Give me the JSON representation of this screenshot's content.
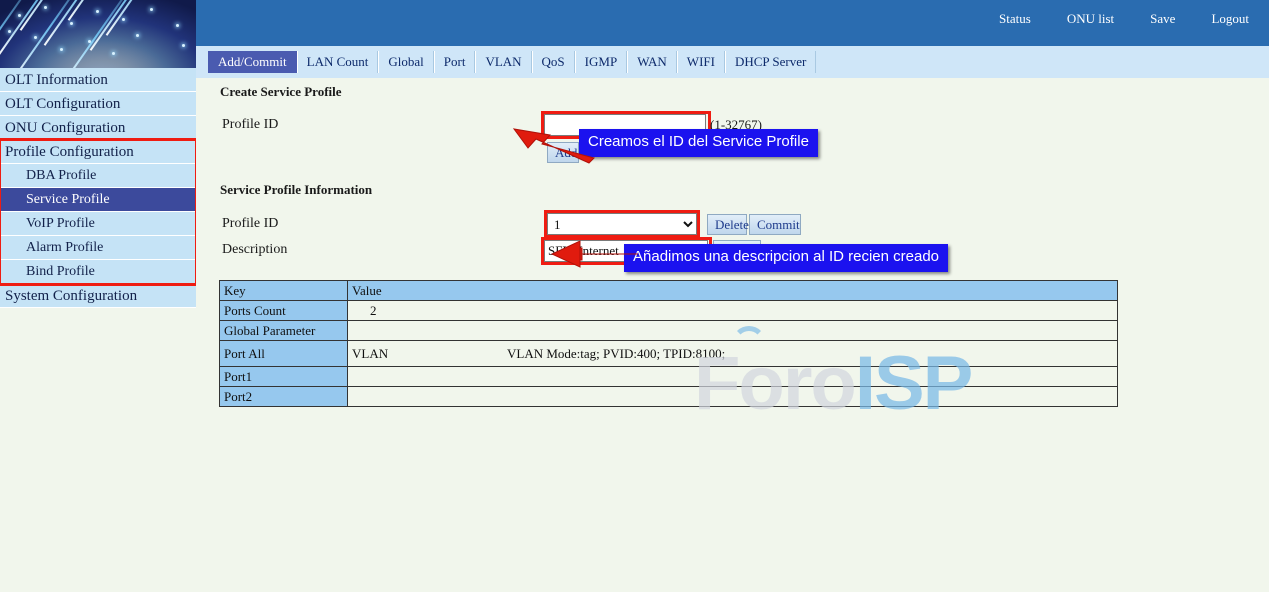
{
  "header": {
    "links": [
      {
        "label": "Status",
        "name": "status"
      },
      {
        "label": "ONU list",
        "name": "onu-list"
      },
      {
        "label": "Save",
        "name": "save"
      },
      {
        "label": "Logout",
        "name": "logout"
      }
    ]
  },
  "sidebar": {
    "items": [
      {
        "label": "OLT Information",
        "level": 0,
        "active": false
      },
      {
        "label": "OLT Configuration",
        "level": 0,
        "active": false
      },
      {
        "label": "ONU Configuration",
        "level": 0,
        "active": false
      },
      {
        "label": "Profile Configuration",
        "level": 0,
        "active": false
      },
      {
        "label": "DBA Profile",
        "level": 1,
        "active": false
      },
      {
        "label": "Service Profile",
        "level": 1,
        "active": true
      },
      {
        "label": "VoIP Profile",
        "level": 1,
        "active": false
      },
      {
        "label": "Alarm Profile",
        "level": 1,
        "active": false
      },
      {
        "label": "Bind Profile",
        "level": 1,
        "active": false
      },
      {
        "label": "System Configuration",
        "level": 0,
        "active": false
      }
    ]
  },
  "tabs": [
    {
      "label": "Add/Commit",
      "active": true
    },
    {
      "label": "LAN Count",
      "active": false
    },
    {
      "label": "Global",
      "active": false
    },
    {
      "label": "Port",
      "active": false
    },
    {
      "label": "VLAN",
      "active": false
    },
    {
      "label": "QoS",
      "active": false
    },
    {
      "label": "IGMP",
      "active": false
    },
    {
      "label": "WAN",
      "active": false
    },
    {
      "label": "WIFI",
      "active": false
    },
    {
      "label": "DHCP Server",
      "active": false
    }
  ],
  "create_section": {
    "title": "Create Service Profile",
    "profile_id_label": "Profile ID",
    "profile_id_value": "",
    "profile_id_placeholder": "",
    "range_hint": "(1-32767)",
    "add_button": "Add"
  },
  "info_section": {
    "title": "Service Profile Information",
    "profile_id_label": "Profile ID",
    "profile_id_selected": "1",
    "profile_id_options": [
      "1"
    ],
    "delete_button": "Delete",
    "commit_button": "Commit",
    "description_label": "Description",
    "description_value": "SFU_Internet",
    "submit_button": "Submit"
  },
  "callouts": [
    {
      "text": "Creamos el ID del Service Profile"
    },
    {
      "text": "Añadimos una descripcion al ID recien creado"
    }
  ],
  "table": {
    "headers": [
      "Key",
      "Value"
    ],
    "rows": [
      {
        "key": "Ports Count",
        "value": "2",
        "sub_key": "",
        "sub_value": ""
      },
      {
        "key": "Global Parameter",
        "value": "",
        "sub_key": "",
        "sub_value": ""
      },
      {
        "key": "Port All",
        "value": "",
        "sub_key": "VLAN",
        "sub_value": "VLAN Mode:tag; PVID:400; TPID:8100;"
      },
      {
        "key": "Port1",
        "value": "",
        "sub_key": "",
        "sub_value": ""
      },
      {
        "key": "Port2",
        "value": "",
        "sub_key": "",
        "sub_value": ""
      }
    ]
  },
  "watermark": {
    "part1": "Foro",
    "part2": "ISP"
  },
  "colors": {
    "header_blue": "#2a6cb0",
    "tabstrip_blue": "#cfe6f8",
    "active_tab": "#4a5bb0",
    "sidebar_item": "#c5e3f6",
    "sidebar_active": "#3c4a9c",
    "annotation_red": "#ef1c12",
    "callout_blue": "#1b12ef",
    "table_header": "#96c8ee",
    "page_bg": "#f1f6ec"
  }
}
